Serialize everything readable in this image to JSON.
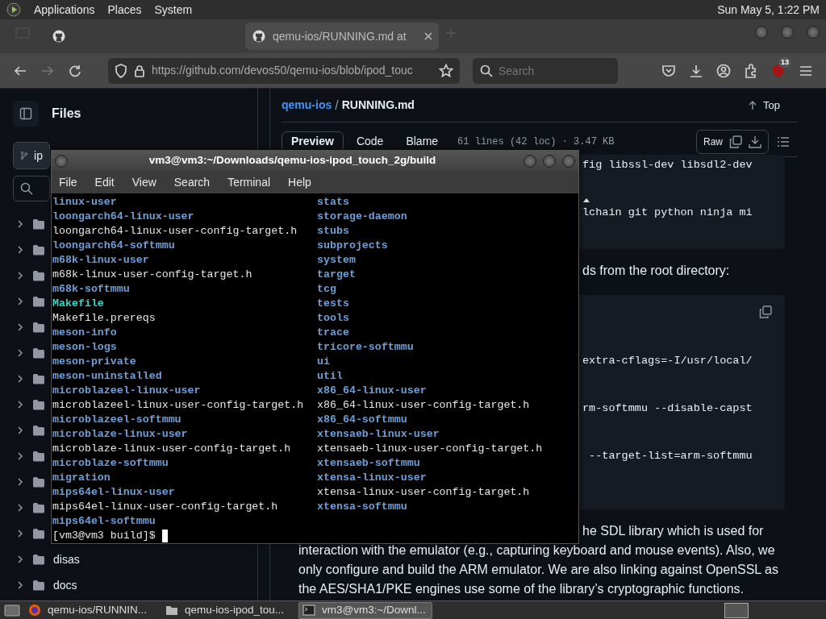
{
  "top_panel": {
    "menus": [
      "Applications",
      "Places",
      "System"
    ],
    "clock": "Sun May 5, 1:22 PM"
  },
  "browser": {
    "tabs": [
      {
        "selected": false
      },
      {
        "title": "qemu-ios/RUNNING.md at",
        "selected": true
      }
    ],
    "url": "https://github.com/devos50/qemu-ios/blob/ipod_touc",
    "search": {
      "placeholder": "Search"
    },
    "extension_badge": "13"
  },
  "sidebar": {
    "title": "Files",
    "branch": "ip",
    "tree": [
      {
        "expanded": false
      },
      {
        "expanded": false
      },
      {
        "expanded": false
      },
      {
        "expanded": false
      },
      {
        "expanded": false
      },
      {
        "expanded": false
      },
      {
        "expanded": false
      },
      {
        "expanded": false
      },
      {
        "expanded": false
      },
      {
        "expanded": false
      },
      {
        "expanded": false
      },
      {
        "expanded": false
      },
      {
        "expanded": false
      },
      {
        "name": "disas",
        "expanded": false
      },
      {
        "name": "docs",
        "expanded": false
      }
    ]
  },
  "file": {
    "repo": "qemu-ios",
    "separator": "/",
    "name": "RUNNING.md",
    "top": "Top",
    "view_tabs": [
      {
        "label": "Preview",
        "selected": true
      },
      {
        "label": "Code",
        "selected": false
      },
      {
        "label": "Blame",
        "selected": false
      }
    ],
    "info": "61 lines (42 loc) · 3.47 KB",
    "raw": "Raw",
    "blocks": [
      {
        "kind": "code",
        "lines": [
          "fig libssl-dev libsdl2-dev",
          "lchain git python ninja mi"
        ]
      },
      {
        "kind": "fragment",
        "lines": [
          "ds from the root directory:"
        ]
      },
      {
        "kind": "code",
        "copy": true,
        "lines": [
          "extra-cflags=-I/usr/local/",
          "rm-softmmu --disable-capst",
          " --target-list=arm-softmmu"
        ]
      },
      {
        "kind": "fragment",
        "lines": [
          "he SDL library which is used for"
        ]
      },
      {
        "kind": "text",
        "lines": [
          "interaction with the emulator (e.g., capturing keyboard and mouse events). Also, we",
          "only configure and build the ARM emulator. We are also linking against OpenSSL as",
          "the AES/SHA1/PKE engines use some of the library’s cryptographic functions."
        ]
      }
    ]
  },
  "terminal": {
    "title": "vm3@vm3:~/Downloads/qemu-ios-ipod_touch_2g/build",
    "menus": [
      "File",
      "Edit",
      "View",
      "Search",
      "Terminal",
      "Help"
    ],
    "columns": [
      [
        {
          "name": "linux-user",
          "kind": "dir"
        },
        {
          "name": "loongarch64-linux-user",
          "kind": "dir"
        },
        {
          "name": "loongarch64-linux-user-config-target.h",
          "kind": "file"
        },
        {
          "name": "loongarch64-softmmu",
          "kind": "dir"
        },
        {
          "name": "m68k-linux-user",
          "kind": "dir"
        },
        {
          "name": "m68k-linux-user-config-target.h",
          "kind": "file"
        },
        {
          "name": "m68k-softmmu",
          "kind": "dir"
        },
        {
          "name": "Makefile",
          "kind": "link"
        },
        {
          "name": "Makefile.prereqs",
          "kind": "file"
        },
        {
          "name": "meson-info",
          "kind": "dir"
        },
        {
          "name": "meson-logs",
          "kind": "dir"
        },
        {
          "name": "meson-private",
          "kind": "dir"
        },
        {
          "name": "meson-uninstalled",
          "kind": "dir"
        },
        {
          "name": "microblazeel-linux-user",
          "kind": "dir"
        },
        {
          "name": "microblazeel-linux-user-config-target.h",
          "kind": "file"
        },
        {
          "name": "microblazeel-softmmu",
          "kind": "dir"
        },
        {
          "name": "microblaze-linux-user",
          "kind": "dir"
        },
        {
          "name": "microblaze-linux-user-config-target.h",
          "kind": "file"
        },
        {
          "name": "microblaze-softmmu",
          "kind": "dir"
        },
        {
          "name": "migration",
          "kind": "dir"
        },
        {
          "name": "mips64el-linux-user",
          "kind": "dir"
        },
        {
          "name": "mips64el-linux-user-config-target.h",
          "kind": "file"
        },
        {
          "name": "mips64el-softmmu",
          "kind": "dir"
        }
      ],
      [
        {
          "name": "stats",
          "kind": "dir"
        },
        {
          "name": "storage-daemon",
          "kind": "dir"
        },
        {
          "name": "stubs",
          "kind": "dir"
        },
        {
          "name": "subprojects",
          "kind": "dir"
        },
        {
          "name": "system",
          "kind": "dir"
        },
        {
          "name": "target",
          "kind": "dir"
        },
        {
          "name": "tcg",
          "kind": "dir"
        },
        {
          "name": "tests",
          "kind": "dir"
        },
        {
          "name": "tools",
          "kind": "dir"
        },
        {
          "name": "trace",
          "kind": "dir"
        },
        {
          "name": "tricore-softmmu",
          "kind": "dir"
        },
        {
          "name": "ui",
          "kind": "dir"
        },
        {
          "name": "util",
          "kind": "dir"
        },
        {
          "name": "x86_64-linux-user",
          "kind": "dir"
        },
        {
          "name": "x86_64-linux-user-config-target.h",
          "kind": "file"
        },
        {
          "name": "x86_64-softmmu",
          "kind": "dir"
        },
        {
          "name": "xtensaeb-linux-user",
          "kind": "dir"
        },
        {
          "name": "xtensaeb-linux-user-config-target.h",
          "kind": "file"
        },
        {
          "name": "xtensaeb-softmmu",
          "kind": "dir"
        },
        {
          "name": "xtensa-linux-user",
          "kind": "dir"
        },
        {
          "name": "xtensa-linux-user-config-target.h",
          "kind": "file"
        },
        {
          "name": "xtensa-softmmu",
          "kind": "dir"
        }
      ]
    ],
    "prompt": "[vm3@vm3 build]$"
  },
  "taskbar": [
    {
      "kind": "browser",
      "label": "qemu-ios/RUNNIN...",
      "selected": false
    },
    {
      "kind": "folder",
      "label": "qemu-ios-ipod_tou...",
      "selected": false
    },
    {
      "kind": "terminal",
      "label": "vm3@vm3:~/Downl...",
      "selected": true
    }
  ]
}
